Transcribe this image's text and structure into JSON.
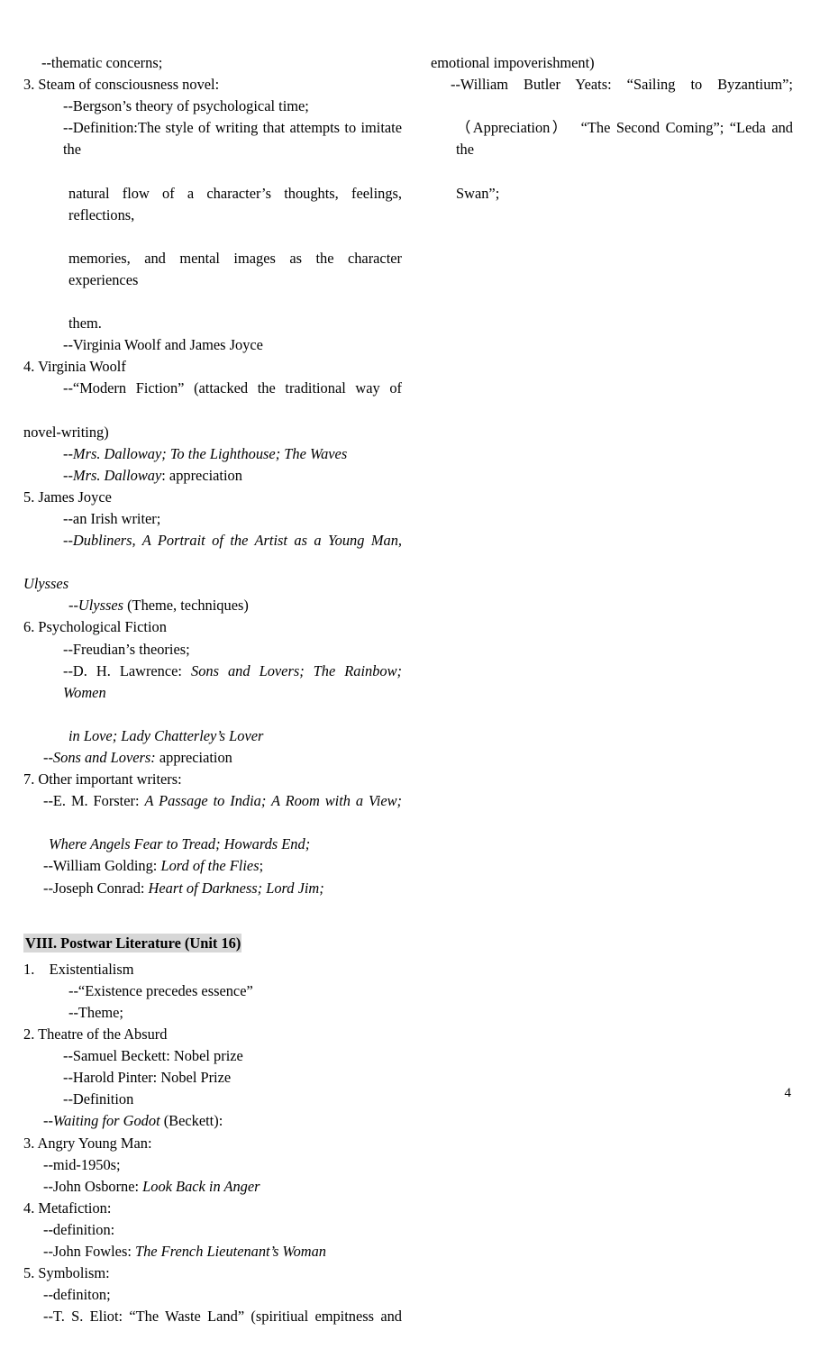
{
  "document": {
    "page_number": "4",
    "highlight_color": "#d7d7d7",
    "text_color": "#000000",
    "background_color": "#ffffff"
  },
  "left_column": {
    "lines": [
      {
        "id": "l01",
        "text": "--thematic concerns;"
      },
      {
        "id": "l02",
        "text": "3. Steam of consciousness novel:"
      },
      {
        "id": "l03",
        "text": "--Bergson’s theory of psychological time;"
      },
      {
        "id": "l04",
        "text": "--Definition:The style of writing that attempts to imitate the"
      },
      {
        "id": "l05",
        "text": "natural flow of a character’s thoughts, feelings, reflections,"
      },
      {
        "id": "l06",
        "text": "memories, and mental images as the character experiences"
      },
      {
        "id": "l07",
        "text": "them."
      },
      {
        "id": "l08",
        "text": "--Virginia Woolf and James Joyce"
      },
      {
        "id": "l09",
        "text": "4. Virginia Woolf"
      },
      {
        "id": "l10",
        "text": "--“Modern Fiction” (attacked the traditional way of"
      },
      {
        "id": "l11",
        "text": "novel-writing)"
      },
      {
        "id": "l12a",
        "text": "--"
      },
      {
        "id": "l12b",
        "text": "Mrs. Dalloway; To the Lighthouse; The Waves"
      },
      {
        "id": "l13a",
        "text": "--"
      },
      {
        "id": "l13b",
        "text": "Mrs. Dalloway"
      },
      {
        "id": "l13c",
        "text": ": appreciation"
      },
      {
        "id": "l14",
        "text": "5. James Joyce"
      },
      {
        "id": "l15",
        "text": "--an Irish writer;"
      },
      {
        "id": "l16a",
        "text": "--"
      },
      {
        "id": "l16b",
        "text": "Dubliners, A Portrait of the Artist as a Young Man,"
      },
      {
        "id": "l17",
        "text": "Ulysses"
      },
      {
        "id": "l18a",
        "text": "--"
      },
      {
        "id": "l18b",
        "text": "Ulysses"
      },
      {
        "id": "l18c",
        "text": " (Theme, techniques)"
      },
      {
        "id": "l19",
        "text": "6. Psychological Fiction"
      },
      {
        "id": "l20",
        "text": "--Freudian’s theories;"
      },
      {
        "id": "l21a",
        "text": "--D. H. Lawrence: "
      },
      {
        "id": "l21b",
        "text": "Sons and Lovers; The Rainbow; Women"
      },
      {
        "id": "l22",
        "text": "in Love; Lady Chatterley’s Lover"
      },
      {
        "id": "l23a",
        "text": "--"
      },
      {
        "id": "l23b",
        "text": "Sons and Lovers:"
      },
      {
        "id": "l23c",
        "text": " appreciation"
      },
      {
        "id": "l24",
        "text": "7. Other important writers:"
      },
      {
        "id": "l25a",
        "text": "--E. M. Forster: "
      },
      {
        "id": "l25b",
        "text": "A Passage to India; A Room with a View;"
      },
      {
        "id": "l26",
        "text": "Where Angels Fear to Tread; Howards End;"
      },
      {
        "id": "l27a",
        "text": "--William Golding: "
      },
      {
        "id": "l27b",
        "text": "Lord of the Flies"
      },
      {
        "id": "l27c",
        "text": ";"
      },
      {
        "id": "l28a",
        "text": "--Joseph Conrad: "
      },
      {
        "id": "l28b",
        "text": "Heart of Darkness; Lord Jim;"
      },
      {
        "id": "h01",
        "text": "VIII. Postwar Literature (Unit 16)"
      },
      {
        "id": "l29",
        "text": "1.    Existentialism"
      },
      {
        "id": "l30",
        "text": "--“Existence precedes essence”"
      },
      {
        "id": "l31",
        "text": "--Theme;"
      },
      {
        "id": "l32",
        "text": "2. Theatre of the Absurd"
      },
      {
        "id": "l33",
        "text": "--Samuel Beckett: Nobel prize"
      },
      {
        "id": "l34",
        "text": "--Harold Pinter: Nobel Prize"
      },
      {
        "id": "l35",
        "text": "--Definition"
      },
      {
        "id": "l36a",
        "text": "--"
      },
      {
        "id": "l36b",
        "text": "Waiting for Godot"
      },
      {
        "id": "l36c",
        "text": " (Beckett):"
      },
      {
        "id": "l37",
        "text": "3. Angry Young Man:"
      },
      {
        "id": "l38",
        "text": "--mid-1950s;"
      },
      {
        "id": "l39a",
        "text": "--John Osborne: "
      },
      {
        "id": "l39b",
        "text": "Look Back in Anger"
      },
      {
        "id": "l40",
        "text": "4. Metafiction:"
      },
      {
        "id": "l41",
        "text": "--definition:"
      },
      {
        "id": "l42a",
        "text": "--John Fowles: "
      },
      {
        "id": "l42b",
        "text": "The French Lieutenant’s Woman"
      },
      {
        "id": "l43",
        "text": "5. Symbolism:"
      },
      {
        "id": "l44",
        "text": "--definiton;"
      },
      {
        "id": "l45",
        "text": "--T. S. Eliot: “The Waste Land” (spiritiual empitness and"
      }
    ]
  },
  "right_column": {
    "lines": [
      {
        "id": "r01",
        "text": "emotional impoverishment)"
      },
      {
        "id": "r02",
        "text": "--William Butler Yeats: “Sailing to Byzantium”;"
      },
      {
        "id": "r03",
        "text": "（Appreciation）  “The Second Coming”; “Leda and the"
      },
      {
        "id": "r04",
        "text": "Swan”;"
      }
    ]
  }
}
